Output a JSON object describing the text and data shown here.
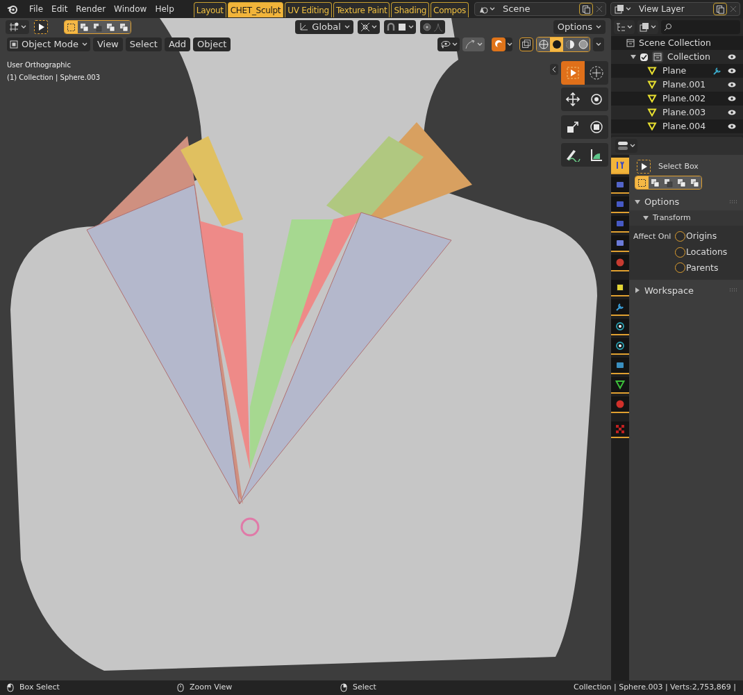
{
  "menu": [
    "File",
    "Edit",
    "Render",
    "Window",
    "Help"
  ],
  "workspaces": [
    {
      "label": "Layout",
      "selected": false
    },
    {
      "label": "CHET_Sculpt",
      "selected": true
    },
    {
      "label": "UV Editing",
      "selected": false
    },
    {
      "label": "Texture Paint",
      "selected": false
    },
    {
      "label": "Shading",
      "selected": false
    },
    {
      "label": "Compos",
      "selected": false
    }
  ],
  "scene": "Scene",
  "view_layer": "View Layer",
  "tool_header": {
    "select_modes": [
      {
        "selected": true
      },
      {
        "selected": false
      },
      {
        "selected": false
      },
      {
        "selected": false
      },
      {
        "selected": false
      }
    ],
    "orientation": "Global",
    "options": "Options"
  },
  "viewport_header": {
    "mode": "Object Mode",
    "menus": [
      "View",
      "Select",
      "Add",
      "Object"
    ],
    "shading": [
      {
        "kind": "wireframe",
        "selected": false
      },
      {
        "kind": "solid",
        "selected": true
      },
      {
        "kind": "material",
        "selected": false
      },
      {
        "kind": "rendered",
        "selected": false
      }
    ]
  },
  "viewport_info": [
    "User Orthographic",
    "(1) Collection | Sphere.003"
  ],
  "toolbar": [
    {
      "kind": "select",
      "selected": true
    },
    {
      "kind": "cursor",
      "selected": false
    },
    {
      "kind": "move",
      "selected": false
    },
    {
      "kind": "rotate",
      "selected": false
    },
    {
      "kind": "scale",
      "selected": false
    },
    {
      "kind": "transform",
      "selected": false
    },
    {
      "kind": "annotate",
      "selected": false
    },
    {
      "kind": "measure",
      "selected": false
    }
  ],
  "outliner": {
    "root": "Scene Collection",
    "children": [
      {
        "label": "Collection",
        "checked": true,
        "expanded": true,
        "children": [
          {
            "label": "Plane",
            "modifier": true
          },
          {
            "label": "Plane.001",
            "modifier": false
          },
          {
            "label": "Plane.002",
            "modifier": false
          },
          {
            "label": "Plane.003",
            "modifier": false
          },
          {
            "label": "Plane.004",
            "modifier": false
          }
        ]
      }
    ]
  },
  "properties": {
    "tabs": [
      {
        "kind": "tool",
        "selected": true
      },
      {
        "kind": "render",
        "selected": false
      },
      {
        "kind": "output",
        "selected": false
      },
      {
        "kind": "view_layer",
        "selected": false
      },
      {
        "kind": "scene",
        "selected": false
      },
      {
        "kind": "world",
        "selected": false
      },
      {
        "kind": "object",
        "selected": false
      },
      {
        "kind": "modifier",
        "selected": false
      },
      {
        "kind": "particles",
        "selected": false
      },
      {
        "kind": "physics",
        "selected": false
      },
      {
        "kind": "constraints",
        "selected": false
      },
      {
        "kind": "data",
        "selected": false
      },
      {
        "kind": "material",
        "selected": false
      },
      {
        "kind": "texture",
        "selected": false
      }
    ],
    "active_tool": "Select Box",
    "select_modes": [
      {
        "selected": true
      },
      {
        "selected": false
      },
      {
        "selected": false
      },
      {
        "selected": false
      },
      {
        "selected": false
      }
    ],
    "options": {
      "label": "Options",
      "expanded": true
    },
    "transform": {
      "label": "Transform",
      "expanded": true
    },
    "affect_label": "Affect Onl",
    "affect": [
      {
        "label": "Origins",
        "checked": false
      },
      {
        "label": "Locations",
        "checked": false
      },
      {
        "label": "Parents",
        "checked": false
      }
    ],
    "workspace": {
      "label": "Workspace",
      "expanded": false
    }
  },
  "status_bar": {
    "hints": [
      "Box Select",
      "Zoom View",
      "Select"
    ],
    "info": "Collection | Sphere.003 | Verts:2,753,869 |"
  }
}
